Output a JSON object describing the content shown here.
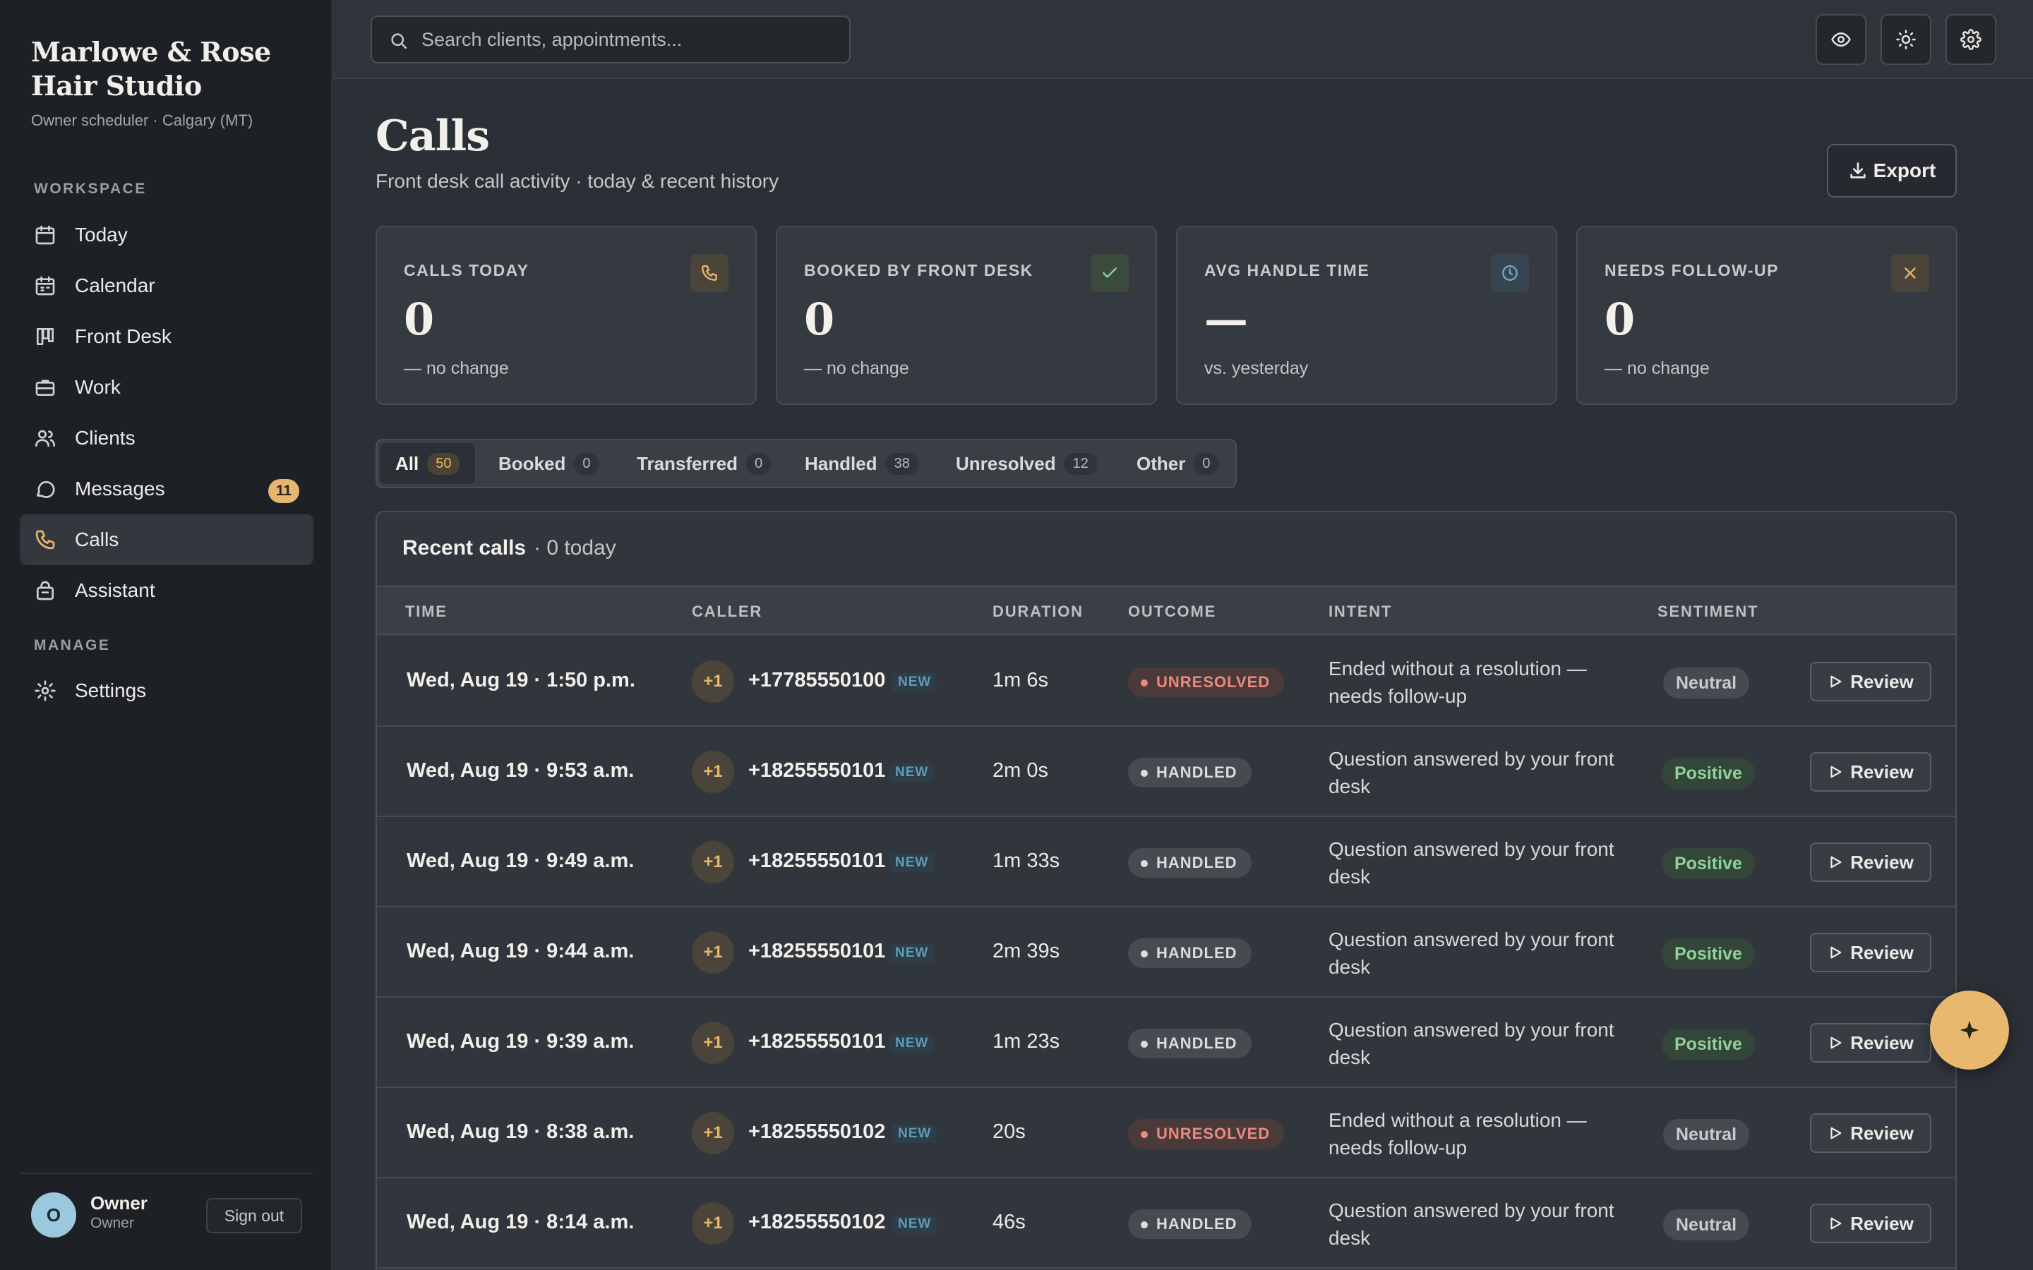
{
  "brand": {
    "name": "Marlowe & Rose Hair Studio",
    "subtitle": "Owner scheduler · Calgary (MT)"
  },
  "nav": {
    "workspace_heading": "WORKSPACE",
    "manage_heading": "MANAGE",
    "items": [
      {
        "label": "Today",
        "icon": "calendar-icon"
      },
      {
        "label": "Calendar",
        "icon": "calendar-grid-icon"
      },
      {
        "label": "Front Desk",
        "icon": "board-icon"
      },
      {
        "label": "Work",
        "icon": "briefcase-icon"
      },
      {
        "label": "Clients",
        "icon": "users-icon"
      },
      {
        "label": "Messages",
        "icon": "chat-icon",
        "badge": "11"
      },
      {
        "label": "Calls",
        "icon": "phone-icon",
        "active": true
      },
      {
        "label": "Assistant",
        "icon": "bag-icon"
      },
      {
        "label": "Settings",
        "icon": "gear-icon"
      }
    ]
  },
  "profile": {
    "initial": "O",
    "name": "Owner",
    "role": "Owner",
    "signout_label": "Sign out"
  },
  "search": {
    "placeholder": "Search clients, appointments..."
  },
  "header": {
    "title": "Calls",
    "subtitle": "Front desk call activity · today & recent history",
    "export_label": "Export"
  },
  "stats": [
    {
      "label": "CALLS TODAY",
      "value": "0",
      "note": "— no change",
      "icon": "phone-icon"
    },
    {
      "label": "BOOKED BY FRONT DESK",
      "value": "0",
      "note": "— no change",
      "icon": "check-icon"
    },
    {
      "label": "AVG HANDLE TIME",
      "value": "—",
      "note": "vs. yesterday",
      "icon": "clock-icon"
    },
    {
      "label": "NEEDS FOLLOW-UP",
      "value": "0",
      "note": "— no change",
      "icon": "close-icon"
    }
  ],
  "tabs": [
    {
      "label": "All",
      "count": "50",
      "active": true
    },
    {
      "label": "Booked",
      "count": "0"
    },
    {
      "label": "Transferred",
      "count": "0"
    },
    {
      "label": "Handled",
      "count": "38"
    },
    {
      "label": "Unresolved",
      "count": "12"
    },
    {
      "label": "Other",
      "count": "0"
    }
  ],
  "table": {
    "title": "Recent calls",
    "count_text": "· 0 today",
    "columns": [
      "TIME",
      "CALLER",
      "DURATION",
      "OUTCOME",
      "INTENT",
      "SENTIMENT"
    ],
    "review_label": "Review",
    "new_tag": "NEW",
    "rows": [
      {
        "time": "Wed, Aug 19 · 1:50 p.m.",
        "cc": "+1",
        "phone": "+17785550100",
        "duration": "1m 6s",
        "outcome": "UNRESOLVED",
        "intent": "Ended without a resolution — needs follow-up",
        "sentiment": "Neutral"
      },
      {
        "time": "Wed, Aug 19 · 9:53 a.m.",
        "cc": "+1",
        "phone": "+18255550101",
        "duration": "2m 0s",
        "outcome": "HANDLED",
        "intent": "Question answered by your front desk",
        "sentiment": "Positive"
      },
      {
        "time": "Wed, Aug 19 · 9:49 a.m.",
        "cc": "+1",
        "phone": "+18255550101",
        "duration": "1m 33s",
        "outcome": "HANDLED",
        "intent": "Question answered by your front desk",
        "sentiment": "Positive"
      },
      {
        "time": "Wed, Aug 19 · 9:44 a.m.",
        "cc": "+1",
        "phone": "+18255550101",
        "duration": "2m 39s",
        "outcome": "HANDLED",
        "intent": "Question answered by your front desk",
        "sentiment": "Positive"
      },
      {
        "time": "Wed, Aug 19 · 9:39 a.m.",
        "cc": "+1",
        "phone": "+18255550101",
        "duration": "1m 23s",
        "outcome": "HANDLED",
        "intent": "Question answered by your front desk",
        "sentiment": "Positive"
      },
      {
        "time": "Wed, Aug 19 · 8:38 a.m.",
        "cc": "+1",
        "phone": "+18255550102",
        "duration": "20s",
        "outcome": "UNRESOLVED",
        "intent": "Ended without a resolution — needs follow-up",
        "sentiment": "Neutral"
      },
      {
        "time": "Wed, Aug 19 · 8:14 a.m.",
        "cc": "+1",
        "phone": "+18255550102",
        "duration": "46s",
        "outcome": "HANDLED",
        "intent": "Question answered by your front desk",
        "sentiment": "Neutral"
      }
    ]
  },
  "colors": {
    "accent": "#e6b66e",
    "positive": "#8fd19a",
    "unresolved": "#ec8a80",
    "sidebar": "#1d2126"
  }
}
